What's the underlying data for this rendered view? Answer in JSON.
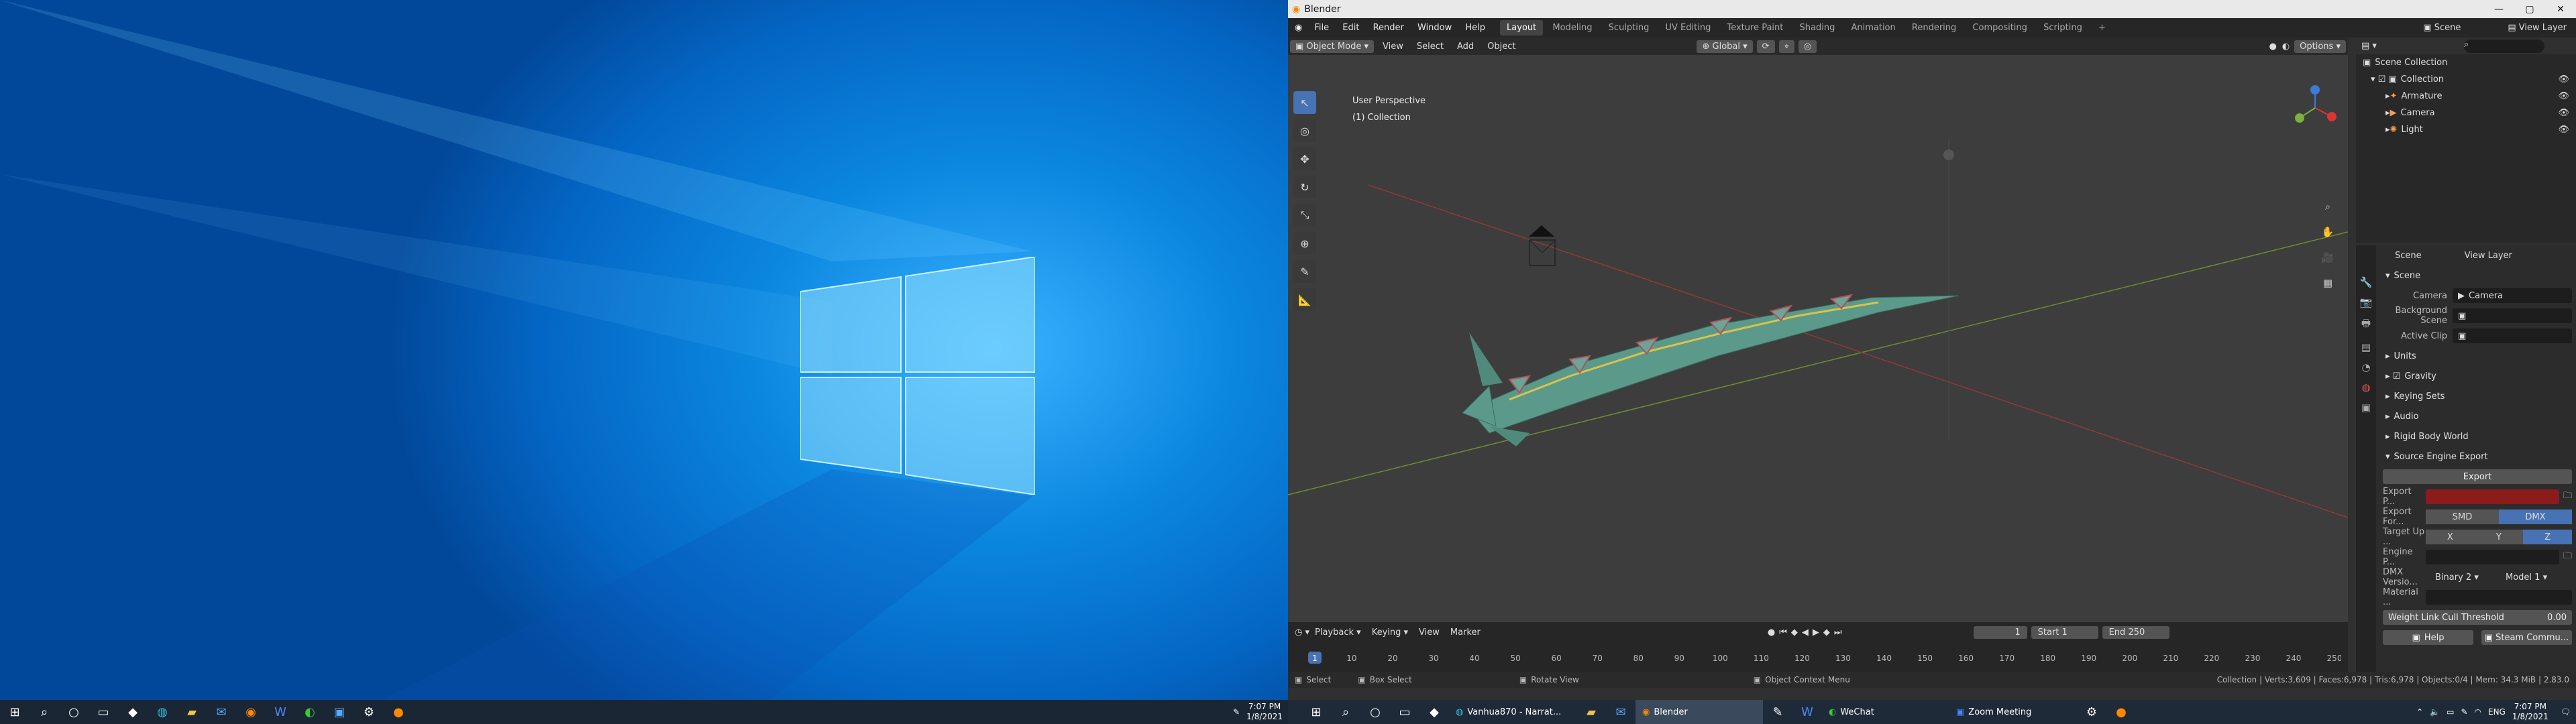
{
  "desktop": {
    "taskbar_left": {
      "clock_time": "7:07 PM",
      "clock_date": "1/8/2021"
    }
  },
  "blender": {
    "window_title": "Blender",
    "menus": [
      "File",
      "Edit",
      "Render",
      "Window",
      "Help"
    ],
    "workspaces": [
      "Layout",
      "Modeling",
      "Sculpting",
      "UV Editing",
      "Texture Paint",
      "Shading",
      "Animation",
      "Rendering",
      "Compositing",
      "Scripting"
    ],
    "active_workspace": "Layout",
    "scene_name": "Scene",
    "view_layer": "View Layer",
    "header": {
      "transform": "Global",
      "options": "Options"
    },
    "viewport_header": {
      "mode": "Object Mode",
      "view": "View",
      "select": "Select",
      "add": "Add",
      "object": "Object"
    },
    "viewport": {
      "perspective": "User Perspective",
      "collection": "(1) Collection"
    },
    "outliner": {
      "root": "Scene Collection",
      "collection": "Collection",
      "items": [
        "Armature",
        "Camera",
        "Light"
      ]
    },
    "properties": {
      "tab_scene": "Scene",
      "tab_view_layer": "View Layer",
      "section_scene": "Scene",
      "camera_label": "Camera",
      "camera_value": "Camera",
      "bg_scene_label": "Background Scene",
      "active_clip_label": "Active Clip",
      "units": "Units",
      "gravity": "Gravity",
      "keying_sets": "Keying Sets",
      "audio": "Audio",
      "rigid_body_world": "Rigid Body World",
      "source_engine_export": "Source Engine Export",
      "export_button": "Export",
      "export_path_label": "Export P...",
      "export_format_label": "Export For...",
      "fmt_smd": "SMD",
      "fmt_dmx": "DMX",
      "target_up_label": "Target Up ...",
      "axis_x": "X",
      "axis_y": "Y",
      "axis_z": "Z",
      "engine_path_label": "Engine P...",
      "dmx_version_label": "DMX Versio...",
      "dmx_binary": "Binary 2",
      "dmx_model": "Model 1",
      "material_label": "Material ...",
      "weight_link_label": "Weight Link Cull Threshold",
      "weight_link_value": "0.00",
      "help_label": "Help",
      "steam_label": "Steam Commu..."
    },
    "timeline": {
      "playback": "Playback",
      "keying": "Keying",
      "view": "View",
      "marker": "Marker",
      "current_frame": "1",
      "start_label": "Start",
      "start": "1",
      "end_label": "End",
      "end": "250",
      "ticks": [
        "1",
        "10",
        "20",
        "30",
        "40",
        "50",
        "60",
        "70",
        "80",
        "90",
        "100",
        "110",
        "120",
        "130",
        "140",
        "150",
        "160",
        "170",
        "180",
        "190",
        "200",
        "210",
        "220",
        "230",
        "240",
        "250"
      ]
    },
    "status": {
      "select": "Select",
      "box_select": "Box Select",
      "rotate_view": "Rotate View",
      "context_menu": "Object Context Menu",
      "stats": "Collection | Verts:3,609 | Faces:6,978 | Tris:6,978 | Objects:0/4 | Mem: 34.3 MiB | 2.83.0"
    }
  },
  "taskbar_right": {
    "apps": [
      "Vanhua870 - Narrat...",
      "Blender",
      "WeChat",
      "Zoom Meeting"
    ],
    "lang": "ENG",
    "clock_time": "7:07 PM",
    "clock_date": "1/8/2021"
  }
}
